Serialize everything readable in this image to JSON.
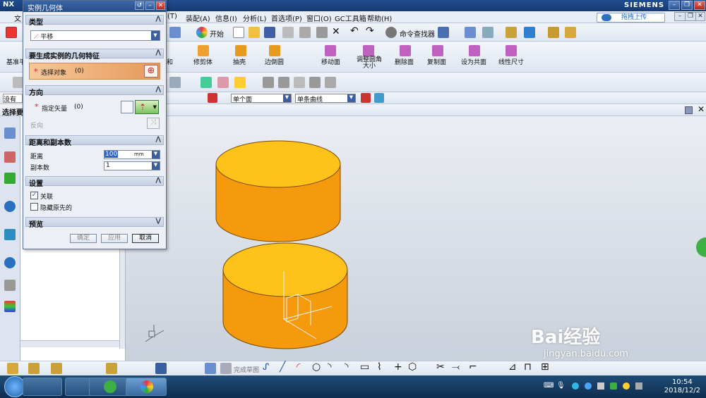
{
  "titlebar": {
    "app": "NX",
    "brand": "SIEMENS"
  },
  "menubar": {
    "partial": "文",
    "items": [
      "(T)",
      "装配(A)",
      "信息(I)",
      "分析(L)",
      "首选项(P)",
      "窗口(O)",
      "GC工具箱",
      "帮助(H)"
    ],
    "upload": "拖拽上传"
  },
  "toolbar1": {
    "start_label": "开始",
    "command_finder": "命令查找器"
  },
  "toolbar2": {
    "partial_left": "基准平",
    "labels": [
      "和",
      "修剪体",
      "抽壳",
      "边倒圆",
      "移动面",
      "调整圆角大小",
      "删除面",
      "复制面",
      "设为共面",
      "线性尺寸"
    ]
  },
  "toolbar4": {
    "partial_left": "没有选",
    "face_filter": "单个面",
    "curve_filter": "单条曲线"
  },
  "selection_label": "选择要",
  "dialog": {
    "title": "实例几何体",
    "type_section": "类型",
    "type_value": "平移",
    "geom_section": "要生成实例的几何特征",
    "select_object": "选择对象",
    "select_count": "(0)",
    "direction_section": "方向",
    "specify_vector": "指定矢量",
    "vector_count": "(0)",
    "reverse": "反向",
    "distance_section": "距离和副本数",
    "distance_label": "距离",
    "distance_value": "100",
    "distance_unit": "mm",
    "copies_label": "副本数",
    "copies_value": "1",
    "settings_section": "设置",
    "associative": "关联",
    "hide_original": "隐藏原先的",
    "preview_section": "预览",
    "ok": "确定",
    "apply": "应用",
    "cancel": "取消"
  },
  "bottombar": {
    "finish_sketch": "完成草图"
  },
  "taskbar": {
    "time": "10:54",
    "date": "2018/12/2"
  },
  "watermark": {
    "text": "Bai经验",
    "url": "jingyan.baidu.com"
  },
  "colors": {
    "cylinder_top": "#ffc21a",
    "cylinder_side": "#f59a0c",
    "titlebar": "#1f4d8f"
  }
}
